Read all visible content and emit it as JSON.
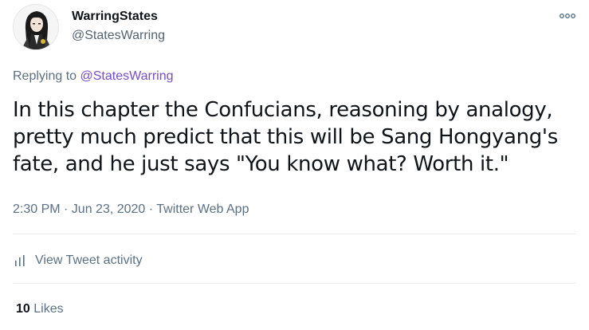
{
  "author": {
    "display_name": "WarringStates",
    "handle": "@StatesWarring"
  },
  "reply_context": {
    "prefix": "Replying to ",
    "mention": "@StatesWarring"
  },
  "tweet": {
    "text_lines": [
      "In this chapter the Confucians, reasoning by analogy,",
      "pretty much predict that this will be Sang Hongyang's",
      "fate, and he just says \"You know what? Worth it.\""
    ],
    "timestamp": "2:30 PM · Jun 23, 2020 · Twitter Web App"
  },
  "actions": {
    "view_activity_label": "View Tweet activity",
    "more_icon": "more-horizontal-icon",
    "activity_icon": "bar-chart-icon"
  },
  "stats": {
    "likes_count": "10",
    "likes_label": "Likes"
  },
  "colors": {
    "text_primary": "#0f1419",
    "text_secondary": "#5b7083",
    "mention": "#794bc4",
    "divider": "#ebeef0"
  }
}
